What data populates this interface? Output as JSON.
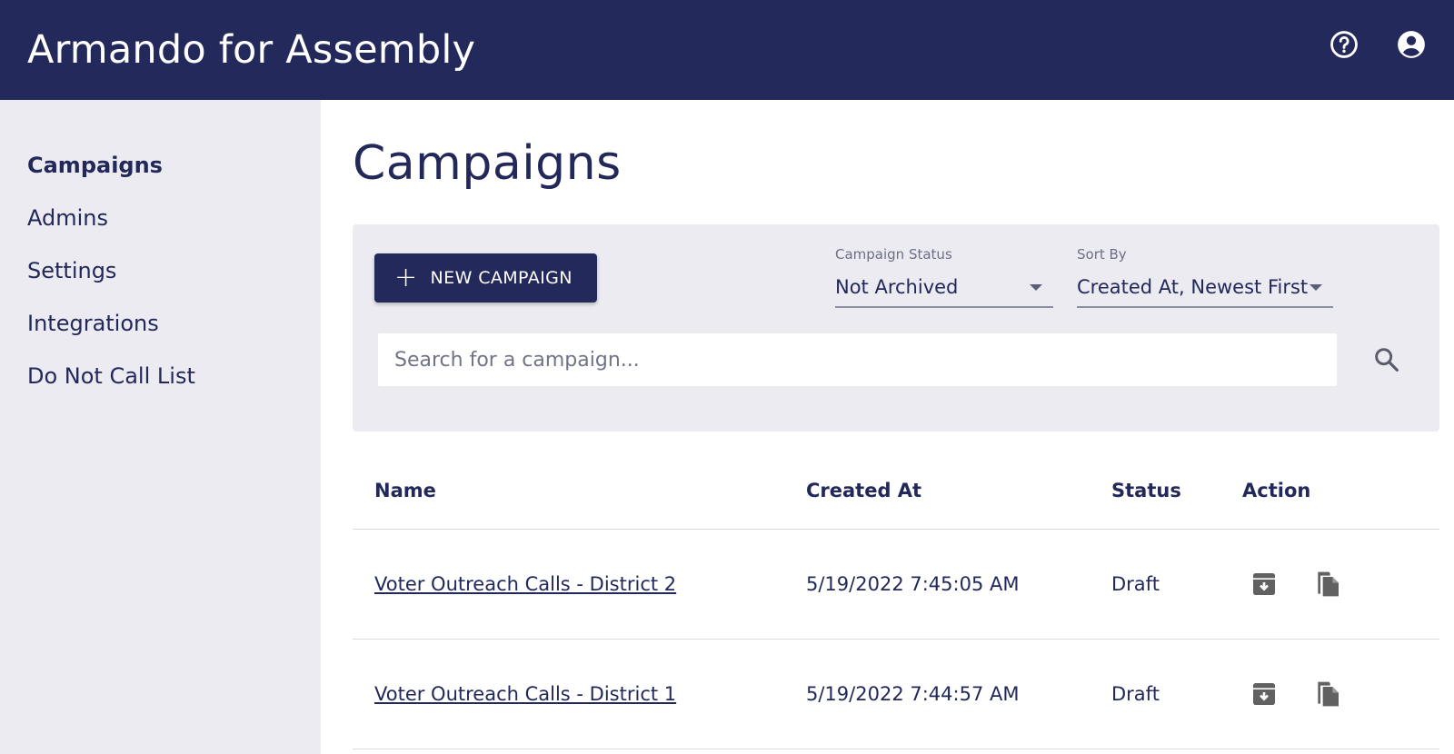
{
  "app": {
    "title": "Armando for Assembly"
  },
  "header": {
    "icons": [
      "help-circle-icon",
      "account-circle-icon"
    ]
  },
  "sidebar": {
    "items": [
      {
        "label": "Campaigns",
        "active": true
      },
      {
        "label": "Admins",
        "active": false
      },
      {
        "label": "Settings",
        "active": false
      },
      {
        "label": "Integrations",
        "active": false
      },
      {
        "label": "Do Not Call List",
        "active": false
      }
    ]
  },
  "main": {
    "title": "Campaigns",
    "new_button_label": "NEW CAMPAIGN",
    "filters": {
      "status_label": "Campaign Status",
      "status_value": "Not Archived",
      "sort_label": "Sort By",
      "sort_value": "Created At, Newest First"
    },
    "search": {
      "placeholder": "Search for a campaign..."
    },
    "table": {
      "columns": [
        "Name",
        "Created At",
        "Status",
        "Action"
      ],
      "rows": [
        {
          "name": "Voter Outreach Calls - District 2",
          "created_at": "5/19/2022 7:45:05 AM",
          "status": "Draft"
        },
        {
          "name": "Voter Outreach Calls - District 1",
          "created_at": "5/19/2022 7:44:57 AM",
          "status": "Draft"
        }
      ]
    }
  },
  "colors": {
    "header_bg": "#24295c",
    "sidebar_bg": "#ebebf1",
    "text": "#22295a",
    "icon_gray": "#616161"
  }
}
